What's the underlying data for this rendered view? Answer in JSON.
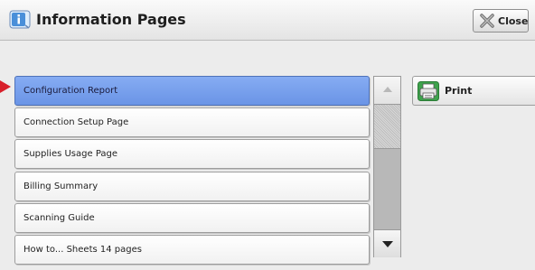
{
  "window": {
    "title": "Information Pages",
    "close_label": "Close"
  },
  "list": {
    "items": [
      {
        "label": "Configuration Report",
        "selected": true
      },
      {
        "label": "Connection Setup Page",
        "selected": false
      },
      {
        "label": "Supplies Usage Page",
        "selected": false
      },
      {
        "label": "Billing Summary",
        "selected": false
      },
      {
        "label": "Scanning Guide",
        "selected": false
      },
      {
        "label": "How to... Sheets 14 pages",
        "selected": false
      }
    ]
  },
  "actions": {
    "print_label": "Print"
  },
  "icons": {
    "title": "info-pages-icon",
    "close": "close-x-icon",
    "print": "printer-icon",
    "pointer": "pointer-arrow-icon"
  },
  "colors": {
    "selected_row": "#7aa0ec",
    "pointer_arrow": "#d81f2a",
    "print_icon_green": "#3fa34d"
  }
}
